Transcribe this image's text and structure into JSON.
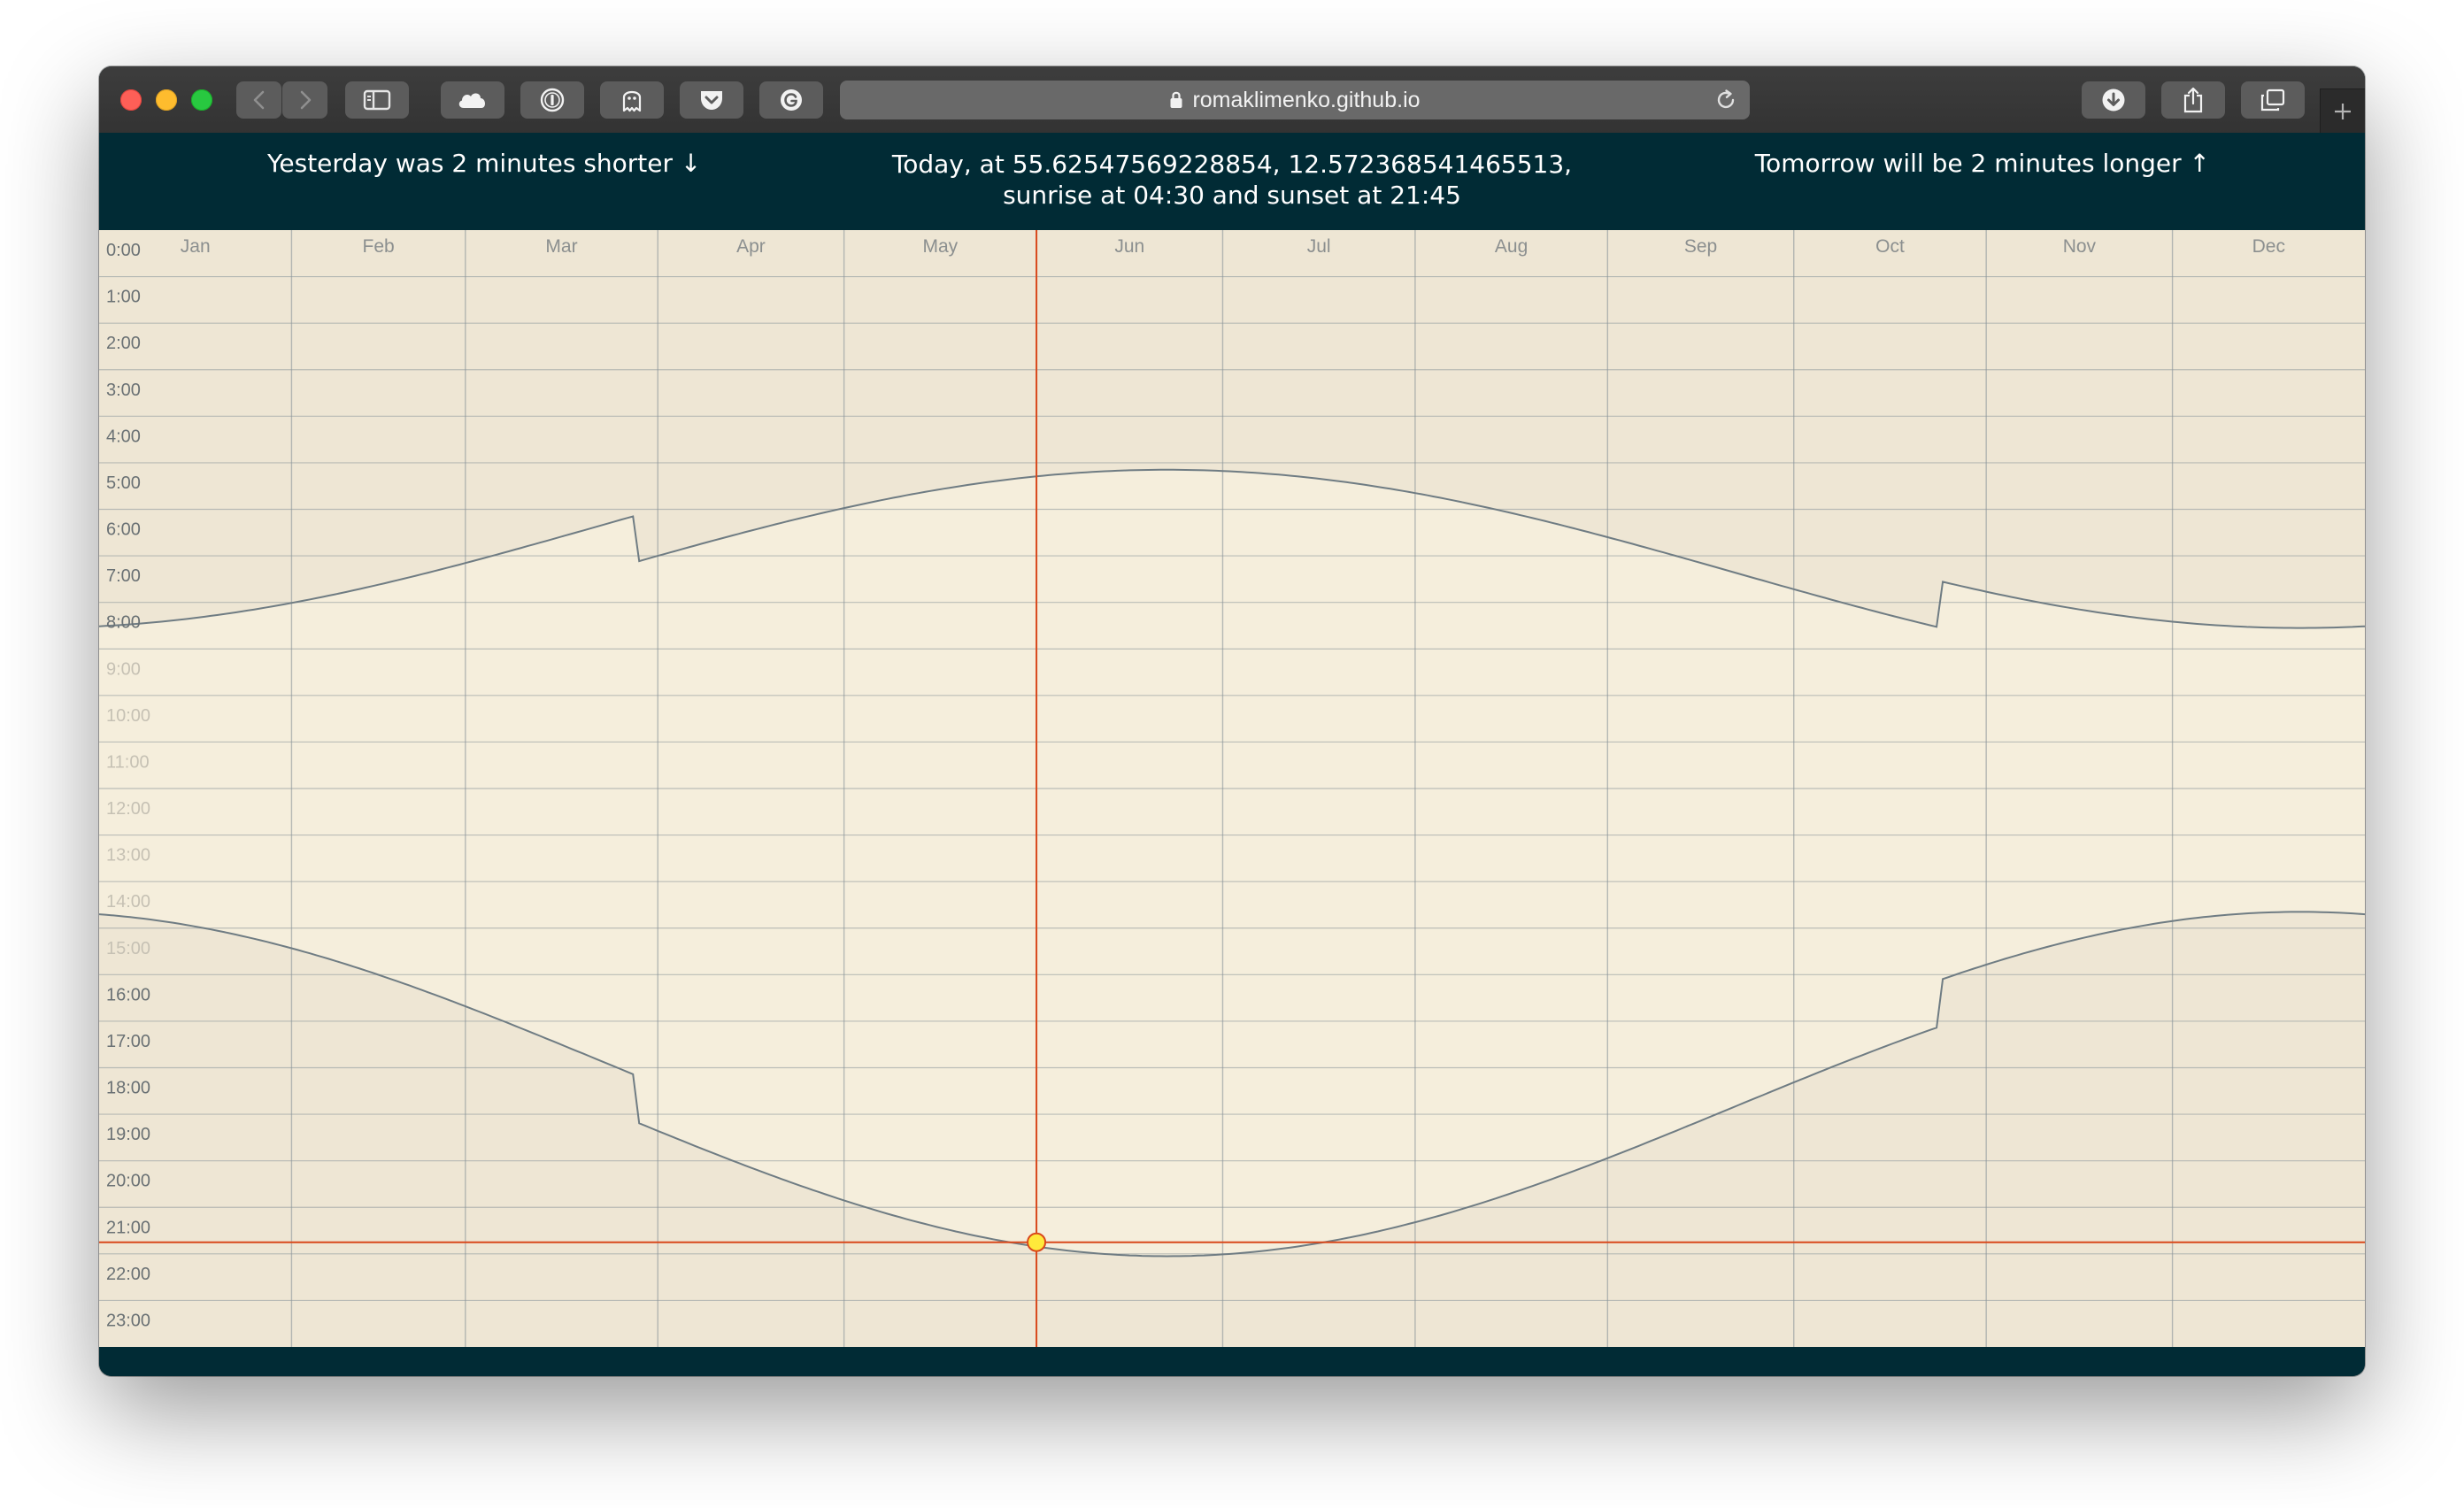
{
  "browser": {
    "url": "romaklimenko.github.io",
    "buttons": [
      {
        "name": "back-button",
        "icon": "chevron-left-icon"
      },
      {
        "name": "forward-button",
        "icon": "chevron-right-icon"
      },
      {
        "name": "sidebar-button",
        "icon": "sidebar-icon"
      },
      {
        "name": "icloud-button",
        "icon": "cloud-icon"
      },
      {
        "name": "password-manager-button",
        "icon": "1password-icon"
      },
      {
        "name": "ghostery-button",
        "icon": "ghost-icon"
      },
      {
        "name": "pocket-button",
        "icon": "pocket-icon"
      },
      {
        "name": "grammarly-button",
        "icon": "grammarly-icon"
      },
      {
        "name": "downloads-button",
        "icon": "download-icon"
      },
      {
        "name": "share-button",
        "icon": "share-icon"
      },
      {
        "name": "tabs-overview-button",
        "icon": "tabs-icon"
      },
      {
        "name": "new-tab-button",
        "icon": "plus-icon"
      }
    ]
  },
  "header": {
    "yesterday": "Yesterday was 2 minutes shorter ↓",
    "today_line1": "Today, at 55.62547569228854, 12.572368541465513,",
    "today_line2": "sunrise at 04:30 and sunset at 21:45",
    "tomorrow": "Tomorrow will be 2 minutes longer ↑"
  },
  "colors": {
    "header_bg": "#012b35",
    "night_bg": "#eee6d4",
    "day_bg": "#f5eedc",
    "grid": "#8a959a",
    "curve": "#6f7c83",
    "cursor": "#d9481b",
    "marker_fill": "#ffe93b"
  },
  "chart_data": {
    "type": "line",
    "months": [
      "Jan",
      "Feb",
      "Mar",
      "Apr",
      "May",
      "Jun",
      "Jul",
      "Aug",
      "Sep",
      "Oct",
      "Nov",
      "Dec"
    ],
    "hour_labels": [
      "0:00",
      "1:00",
      "2:00",
      "3:00",
      "4:00",
      "5:00",
      "6:00",
      "7:00",
      "8:00",
      "9:00",
      "10:00",
      "11:00",
      "12:00",
      "13:00",
      "14:00",
      "15:00",
      "16:00",
      "17:00",
      "18:00",
      "19:00",
      "20:00",
      "21:00",
      "22:00",
      "23:00"
    ],
    "x_unit": "day of year (Jan 1 = 0)",
    "y_unit": "hours since midnight",
    "ylim": [
      0,
      24
    ],
    "dst": {
      "start_day": 87,
      "end_day": 297,
      "shift_hours": 1
    },
    "sunrise_hours": {
      "base": 6.35,
      "amplitude": 2.2,
      "solstice_day": 172
    },
    "sunset_hours": {
      "base": 17.85,
      "amplitude": 3.2,
      "solstice_day": 172
    },
    "today": {
      "day": 151,
      "sunset_hours": 21.75
    }
  }
}
